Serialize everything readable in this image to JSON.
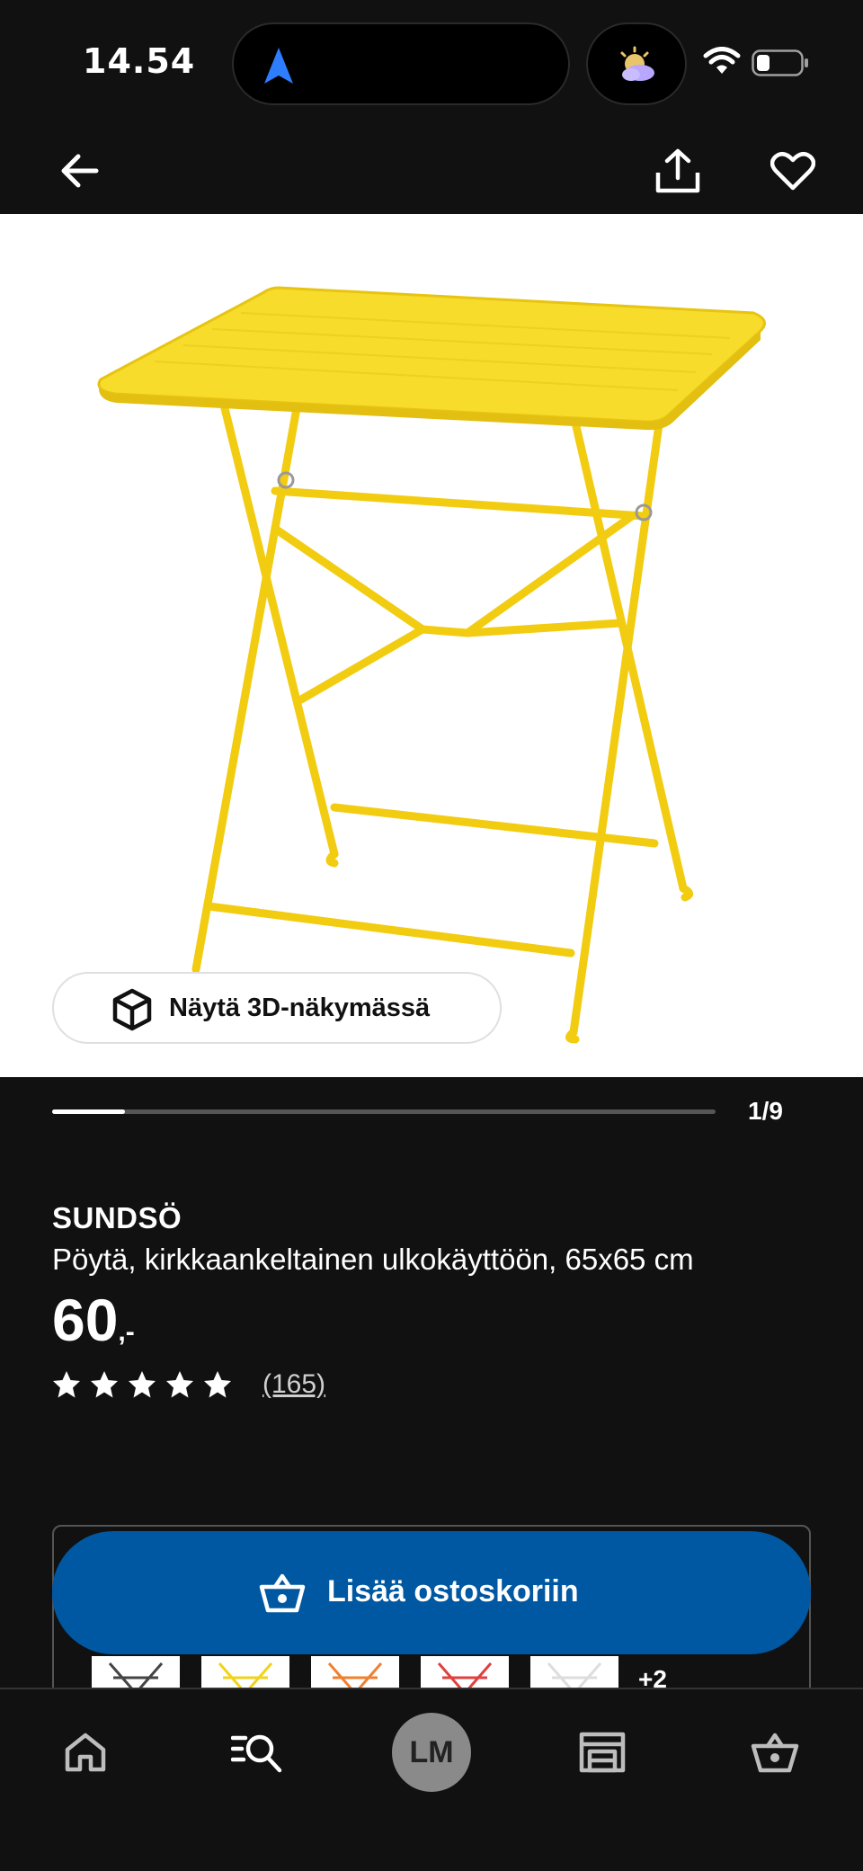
{
  "status_bar": {
    "time": "14.54"
  },
  "nav": {
    "back_icon": "arrow-left-icon",
    "share_icon": "share-icon",
    "favorite_icon": "heart-icon"
  },
  "product_image": {
    "view_3d_label": "Näytä 3D-näkymässä",
    "counter": "1/9",
    "progress_fraction": 0.11
  },
  "product": {
    "name": "SUNDSÖ",
    "description": "Pöytä, kirkkaankeltainen ulkokäyttöön, 65x65 cm",
    "price_int": "60",
    "price_suffix": ",-",
    "rating_stars": 5,
    "review_count": "(165)"
  },
  "variants": {
    "more_label": "+2",
    "thumb_colors": [
      "#444444",
      "#f2d21c",
      "#f08030",
      "#e04040",
      "#dddddd"
    ]
  },
  "cart_button": {
    "label": "Lisää ostoskoriin"
  },
  "tab_bar": {
    "profile_initials": "LM"
  },
  "colors": {
    "background": "#111111",
    "accent_blue": "#0058a3",
    "table_yellow": "#f5d314"
  }
}
